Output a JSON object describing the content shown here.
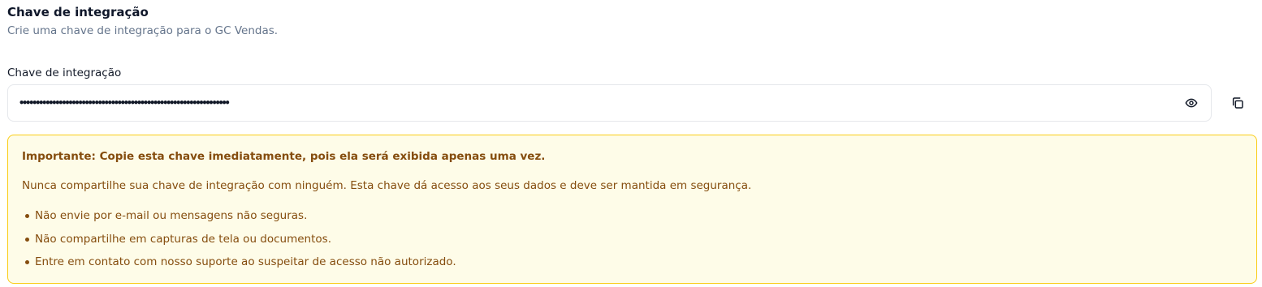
{
  "section": {
    "title": "Chave de integração",
    "subtitle": "Crie uma chave de integração para o GC Vendas."
  },
  "key_field": {
    "label": "Chave de integração",
    "value": "••••••••••••••••••••••••••••••••••••••••••••••••••••••••••••••••",
    "toggle_icon": "eye-icon",
    "copy_icon": "copy-icon"
  },
  "warning": {
    "title": "Importante: Copie esta chave imediatamente, pois ela será exibida apenas uma vez.",
    "body": "Nunca compartilhe sua chave de integração com ninguém. Esta chave dá acesso aos seus dados e deve ser mantida em segurança.",
    "items": [
      "Não envie por e-mail ou mensagens não seguras.",
      "Não compartilhe em capturas de tela ou documentos.",
      "Entre em contato com nosso suporte ao suspeitar de acesso não autorizado."
    ],
    "colors": {
      "background": "#fefce8",
      "border": "#facc15",
      "text": "#854d0e"
    }
  }
}
